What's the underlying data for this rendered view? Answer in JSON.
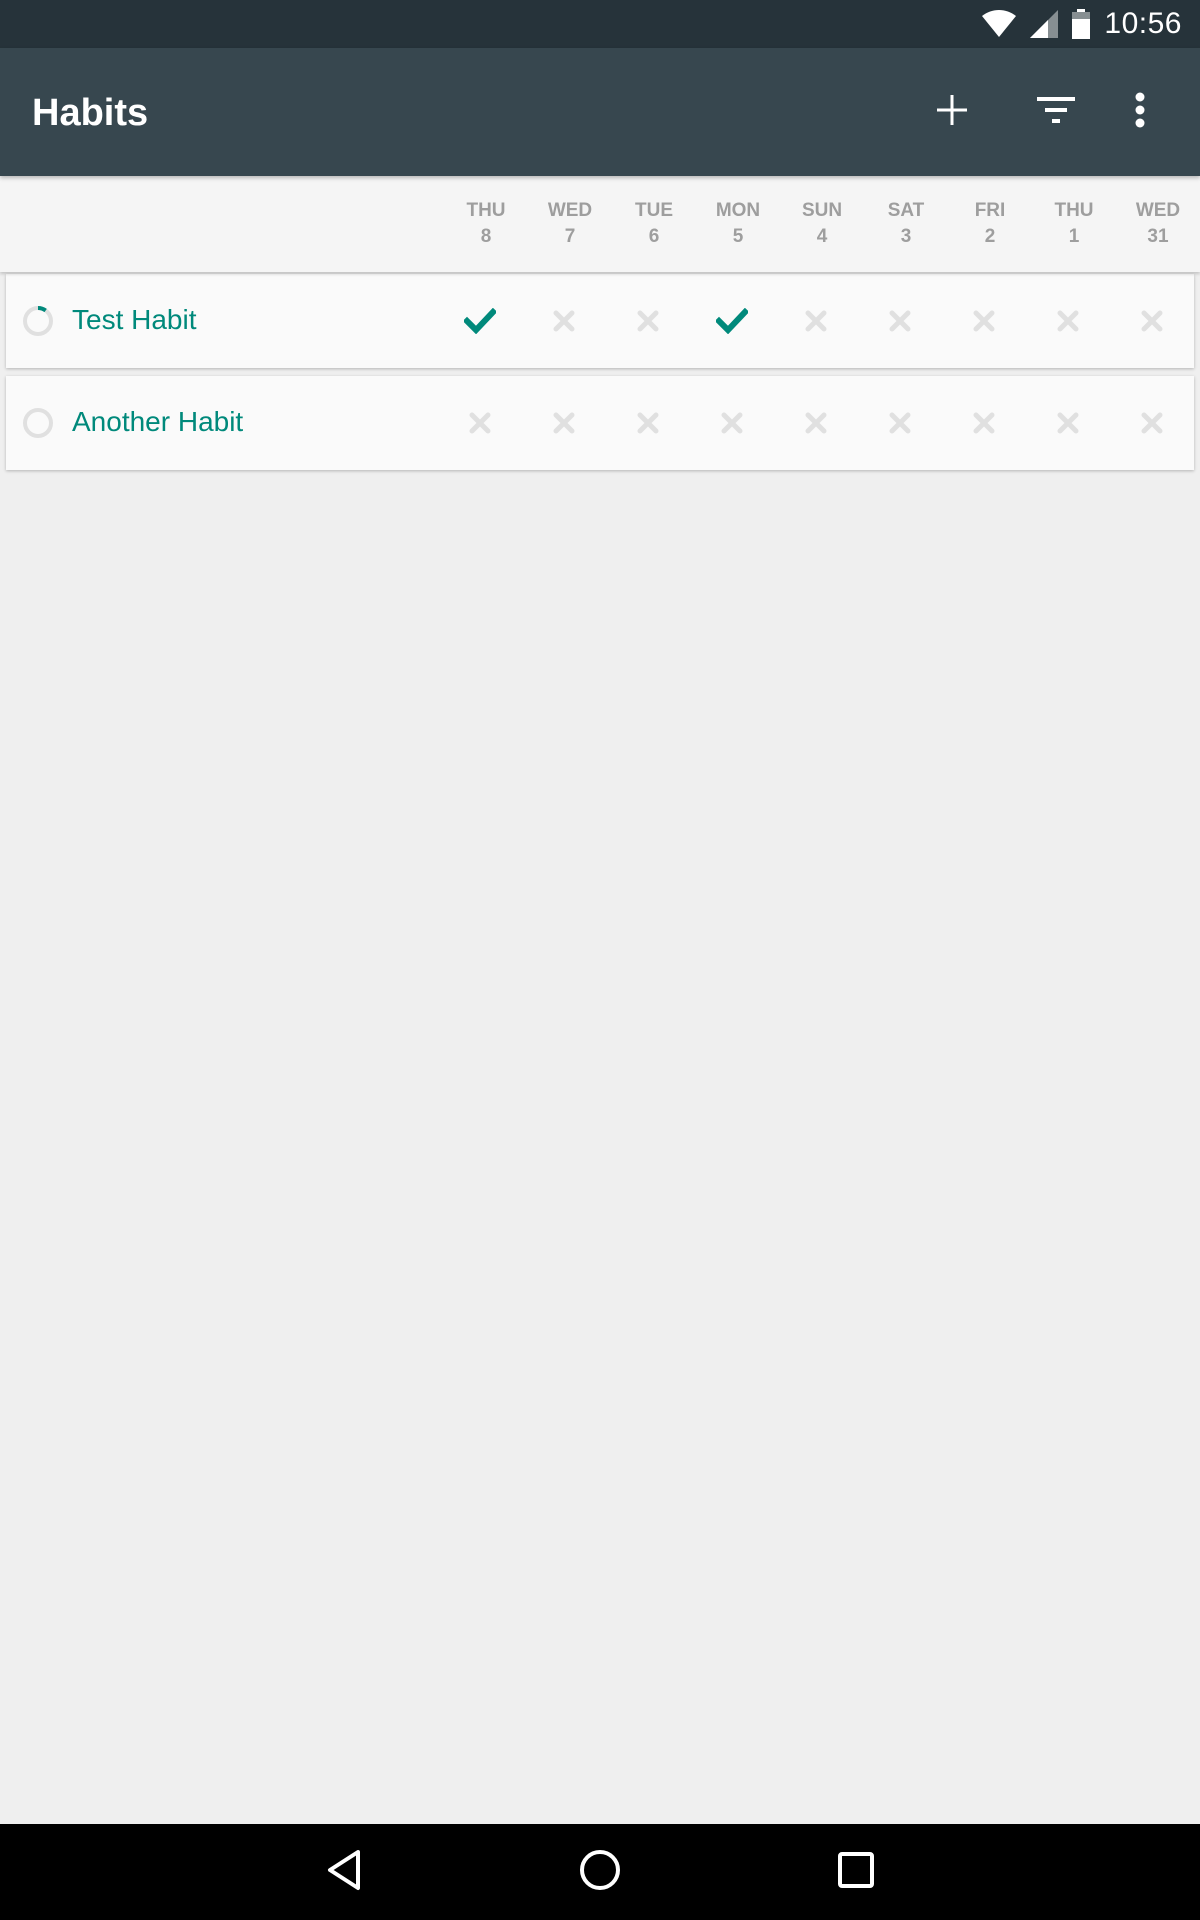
{
  "status_bar": {
    "time": "10:56"
  },
  "app_bar": {
    "title": "Habits"
  },
  "days": [
    {
      "weekday": "THU",
      "date": "8"
    },
    {
      "weekday": "WED",
      "date": "7"
    },
    {
      "weekday": "TUE",
      "date": "6"
    },
    {
      "weekday": "MON",
      "date": "5"
    },
    {
      "weekday": "SUN",
      "date": "4"
    },
    {
      "weekday": "SAT",
      "date": "3"
    },
    {
      "weekday": "FRI",
      "date": "2"
    },
    {
      "weekday": "THU",
      "date": "1"
    },
    {
      "weekday": "WED",
      "date": "31"
    }
  ],
  "habits": [
    {
      "name": "Test Habit",
      "score": 0.1,
      "checks": [
        true,
        false,
        false,
        true,
        false,
        false,
        false,
        false,
        false
      ]
    },
    {
      "name": "Another Habit",
      "score": 0,
      "checks": [
        false,
        false,
        false,
        false,
        false,
        false,
        false,
        false,
        false
      ]
    }
  ],
  "colors": {
    "accent": "#00897b",
    "appbar": "#37474f",
    "statusbar": "#26333a",
    "unchecked": "#e0e0e0"
  }
}
